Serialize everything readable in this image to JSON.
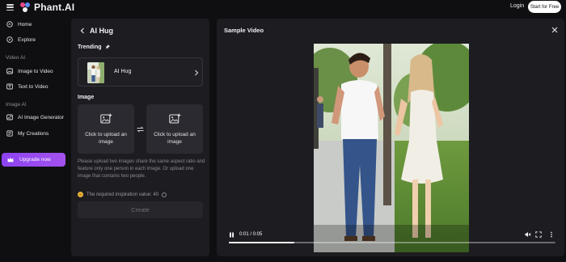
{
  "app": {
    "brand": "Phant.AI"
  },
  "header": {
    "login_label": "Login",
    "start_label": "Start for Free"
  },
  "sidebar": {
    "items": [
      {
        "label": "Home",
        "icon": "home-icon"
      },
      {
        "label": "Explore",
        "icon": "compass-icon"
      }
    ],
    "sections": [
      {
        "title": "Video AI",
        "items": [
          {
            "label": "Image to Video",
            "icon": "image-video-icon"
          },
          {
            "label": "Text to Video",
            "icon": "text-video-icon"
          }
        ]
      },
      {
        "title": "Image AI",
        "items": [
          {
            "label": "AI Image Generator",
            "icon": "image-gen-icon"
          },
          {
            "label": "My Creations",
            "icon": "creations-icon"
          }
        ]
      }
    ],
    "upgrade_label": "Upgrade now"
  },
  "left_panel": {
    "title": "AI Hug",
    "trending_label": "Trending",
    "trending_item": {
      "name": "AI Hug"
    },
    "image_label": "Image",
    "upload_slots": [
      {
        "label": "Click to upload an image"
      },
      {
        "label": "Click to upload an image"
      }
    ],
    "hint": "Please upload two images share the same aspect ratio and feature only one person in each image. Or upload one image that contains two people.",
    "requirement": "The required inspiration value: 40",
    "create_label": "Create"
  },
  "right_panel": {
    "title": "Sample Video",
    "player": {
      "time": "0:01 / 0:05",
      "progress": 0.2
    }
  },
  "colors": {
    "accent": "#9b4af0",
    "background": "#0f0f12",
    "panel": "#1c1c21"
  }
}
